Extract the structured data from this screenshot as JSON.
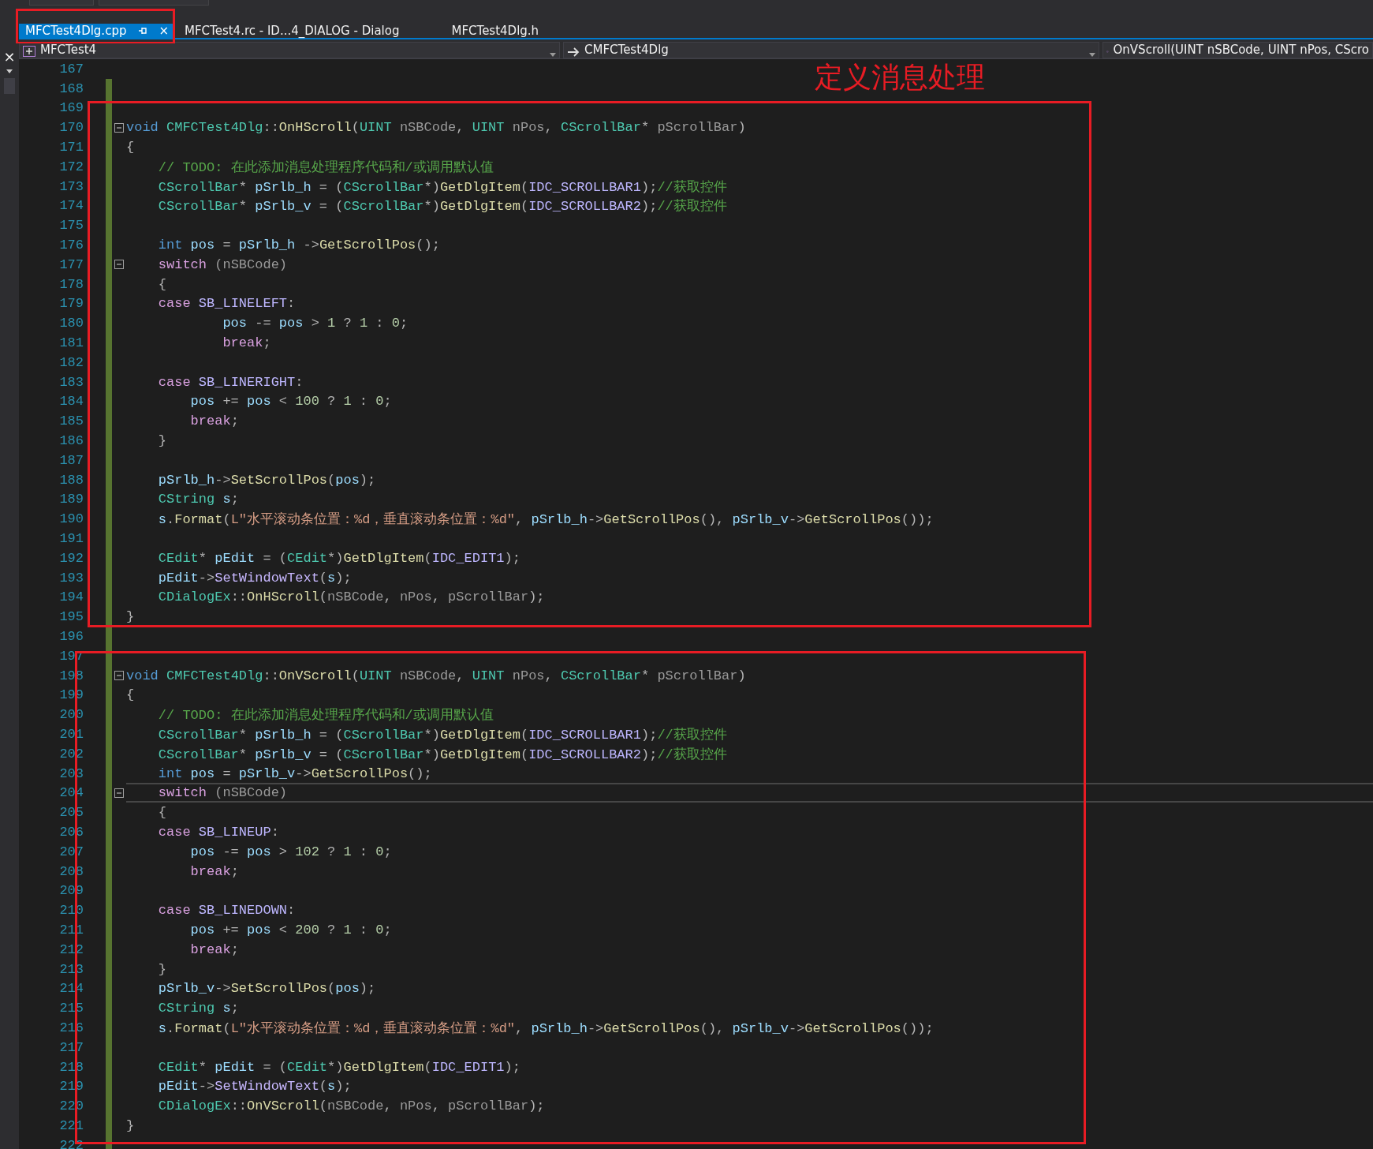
{
  "side_panel": {
    "close": "×"
  },
  "tabs": [
    {
      "label": "MFCTest4Dlg.cpp",
      "selected": true,
      "pinned": true,
      "close": "×"
    },
    {
      "label": "MFCTest4.rc - ID...4_DIALOG - Dialog",
      "selected": false
    },
    {
      "label": "MFCTest4Dlg.h",
      "selected": false
    }
  ],
  "navigation": {
    "project": "MFCTest4",
    "class": "CMFCTest4Dlg",
    "member": "OnVScroll(UINT nSBCode, UINT nPos, CScro"
  },
  "annotation": {
    "label": "定义消息处理"
  },
  "lines": [
    {
      "number": "167",
      "changed": false,
      "current": false
    },
    {
      "number": "168",
      "changed": true,
      "current": false
    },
    {
      "number": "169",
      "changed": true,
      "current": false
    },
    {
      "number": "170",
      "changed": true,
      "current": false,
      "expanded": true,
      "tokens": [
        {
          "kind": "keyword",
          "text": "void"
        },
        {
          "kind": "type",
          "text": " CMFCTest4Dlg"
        },
        {
          "kind": "op",
          "text": "::"
        },
        {
          "kind": "function",
          "text": "OnHScroll"
        },
        {
          "kind": "op",
          "text": "("
        },
        {
          "kind": "type",
          "text": "UINT"
        },
        {
          "kind": "param",
          "text": " nSBCode"
        },
        {
          "kind": "op",
          "text": ", "
        },
        {
          "kind": "type",
          "text": "UINT"
        },
        {
          "kind": "param",
          "text": " nPos"
        },
        {
          "kind": "op",
          "text": ", "
        },
        {
          "kind": "type",
          "text": "CScrollBar"
        },
        {
          "kind": "op",
          "text": "* "
        },
        {
          "kind": "param",
          "text": "pScrollBar"
        },
        {
          "kind": "op",
          "text": ")"
        }
      ]
    },
    {
      "number": "171",
      "changed": true,
      "current": false,
      "tokens": [
        {
          "kind": "op",
          "text": "{"
        }
      ]
    },
    {
      "number": "172",
      "changed": true,
      "current": false,
      "tokens": [
        {
          "kind": "comment",
          "text": "    // TODO: 在此添加消息处理程序代码和/或调用默认值"
        }
      ]
    },
    {
      "number": "173",
      "changed": true,
      "current": false,
      "tokens": [
        {
          "kind": "type",
          "text": "    CScrollBar"
        },
        {
          "kind": "op",
          "text": "* "
        },
        {
          "kind": "variable",
          "text": "pSrlb_h"
        },
        {
          "kind": "op",
          "text": " = ("
        },
        {
          "kind": "type",
          "text": "CScrollBar"
        },
        {
          "kind": "op",
          "text": "*)"
        },
        {
          "kind": "function",
          "text": "GetDlgItem"
        },
        {
          "kind": "op",
          "text": "("
        },
        {
          "kind": "macro",
          "text": "IDC_SCROLLBAR1"
        },
        {
          "kind": "op",
          "text": ");"
        },
        {
          "kind": "comment",
          "text": "//获取控件"
        }
      ]
    },
    {
      "number": "174",
      "changed": true,
      "current": false,
      "tokens": [
        {
          "kind": "type",
          "text": "    CScrollBar"
        },
        {
          "kind": "op",
          "text": "* "
        },
        {
          "kind": "variable",
          "text": "pSrlb_v"
        },
        {
          "kind": "op",
          "text": " = ("
        },
        {
          "kind": "type",
          "text": "CScrollBar"
        },
        {
          "kind": "op",
          "text": "*)"
        },
        {
          "kind": "function",
          "text": "GetDlgItem"
        },
        {
          "kind": "op",
          "text": "("
        },
        {
          "kind": "macro",
          "text": "IDC_SCROLLBAR2"
        },
        {
          "kind": "op",
          "text": ");"
        },
        {
          "kind": "comment",
          "text": "//获取控件"
        }
      ]
    },
    {
      "number": "175",
      "changed": true,
      "current": false
    },
    {
      "number": "176",
      "changed": true,
      "current": false,
      "tokens": [
        {
          "kind": "keyword",
          "text": "    int"
        },
        {
          "kind": "variable",
          "text": " pos"
        },
        {
          "kind": "op",
          "text": " = "
        },
        {
          "kind": "variable",
          "text": "pSrlb_h"
        },
        {
          "kind": "op",
          "text": " ->"
        },
        {
          "kind": "function",
          "text": "GetScrollPos"
        },
        {
          "kind": "op",
          "text": "();"
        }
      ]
    },
    {
      "number": "177",
      "changed": true,
      "current": false,
      "expanded": true,
      "tokens": [
        {
          "kind": "control",
          "text": "    switch"
        },
        {
          "kind": "param",
          "text": " (nSBCode)"
        }
      ]
    },
    {
      "number": "178",
      "changed": true,
      "current": false,
      "tokens": [
        {
          "kind": "op",
          "text": "    {"
        }
      ]
    },
    {
      "number": "179",
      "changed": true,
      "current": false,
      "tokens": [
        {
          "kind": "control",
          "text": "    case"
        },
        {
          "kind": "macro",
          "text": " SB_LINELEFT"
        },
        {
          "kind": "op",
          "text": ":"
        }
      ]
    },
    {
      "number": "180",
      "changed": true,
      "current": false,
      "tokens": [
        {
          "kind": "variable",
          "text": "            pos"
        },
        {
          "kind": "op",
          "text": " -= "
        },
        {
          "kind": "variable",
          "text": "pos"
        },
        {
          "kind": "op",
          "text": " > "
        },
        {
          "kind": "number",
          "text": "1"
        },
        {
          "kind": "op",
          "text": " ? "
        },
        {
          "kind": "number",
          "text": "1"
        },
        {
          "kind": "op",
          "text": " : "
        },
        {
          "kind": "number",
          "text": "0"
        },
        {
          "kind": "op",
          "text": ";"
        }
      ]
    },
    {
      "number": "181",
      "changed": true,
      "current": false,
      "tokens": [
        {
          "kind": "control",
          "text": "            break"
        },
        {
          "kind": "op",
          "text": ";"
        }
      ]
    },
    {
      "number": "182",
      "changed": true,
      "current": false
    },
    {
      "number": "183",
      "changed": true,
      "current": false,
      "tokens": [
        {
          "kind": "control",
          "text": "    case"
        },
        {
          "kind": "macro",
          "text": " SB_LINERIGHT"
        },
        {
          "kind": "op",
          "text": ":"
        }
      ]
    },
    {
      "number": "184",
      "changed": true,
      "current": false,
      "tokens": [
        {
          "kind": "variable",
          "text": "        pos"
        },
        {
          "kind": "op",
          "text": " += "
        },
        {
          "kind": "variable",
          "text": "pos"
        },
        {
          "kind": "op",
          "text": " < "
        },
        {
          "kind": "number",
          "text": "100"
        },
        {
          "kind": "op",
          "text": " ? "
        },
        {
          "kind": "number",
          "text": "1"
        },
        {
          "kind": "op",
          "text": " : "
        },
        {
          "kind": "number",
          "text": "0"
        },
        {
          "kind": "op",
          "text": ";"
        }
      ]
    },
    {
      "number": "185",
      "changed": true,
      "current": false,
      "tokens": [
        {
          "kind": "control",
          "text": "        break"
        },
        {
          "kind": "op",
          "text": ";"
        }
      ]
    },
    {
      "number": "186",
      "changed": true,
      "current": false,
      "tokens": [
        {
          "kind": "op",
          "text": "    }"
        }
      ]
    },
    {
      "number": "187",
      "changed": true,
      "current": false
    },
    {
      "number": "188",
      "changed": true,
      "current": false,
      "tokens": [
        {
          "kind": "variable",
          "text": "    pSrlb_h"
        },
        {
          "kind": "op",
          "text": "->"
        },
        {
          "kind": "function",
          "text": "SetScrollPos"
        },
        {
          "kind": "op",
          "text": "("
        },
        {
          "kind": "variable",
          "text": "pos"
        },
        {
          "kind": "op",
          "text": ");"
        }
      ]
    },
    {
      "number": "189",
      "changed": true,
      "current": false,
      "tokens": [
        {
          "kind": "type",
          "text": "    CString"
        },
        {
          "kind": "variable",
          "text": " s"
        },
        {
          "kind": "op",
          "text": ";"
        }
      ]
    },
    {
      "number": "190",
      "changed": true,
      "current": false,
      "tokens": [
        {
          "kind": "variable",
          "text": "    s"
        },
        {
          "kind": "op",
          "text": "."
        },
        {
          "kind": "function",
          "text": "Format"
        },
        {
          "kind": "op",
          "text": "("
        },
        {
          "kind": "string",
          "text": "L\"水平滚动条位置：%d，垂直滚动条位置：%d\""
        },
        {
          "kind": "op",
          "text": ", "
        },
        {
          "kind": "variable",
          "text": "pSrlb_h"
        },
        {
          "kind": "op",
          "text": "->"
        },
        {
          "kind": "function",
          "text": "GetScrollPos"
        },
        {
          "kind": "op",
          "text": "(), "
        },
        {
          "kind": "variable",
          "text": "pSrlb_v"
        },
        {
          "kind": "op",
          "text": "->"
        },
        {
          "kind": "function",
          "text": "GetScrollPos"
        },
        {
          "kind": "op",
          "text": "());"
        }
      ]
    },
    {
      "number": "191",
      "changed": true,
      "current": false
    },
    {
      "number": "192",
      "changed": true,
      "current": false,
      "tokens": [
        {
          "kind": "type",
          "text": "    CEdit"
        },
        {
          "kind": "op",
          "text": "* "
        },
        {
          "kind": "variable",
          "text": "pEdit"
        },
        {
          "kind": "op",
          "text": " = ("
        },
        {
          "kind": "type",
          "text": "CEdit"
        },
        {
          "kind": "op",
          "text": "*)"
        },
        {
          "kind": "function",
          "text": "GetDlgItem"
        },
        {
          "kind": "op",
          "text": "("
        },
        {
          "kind": "macro",
          "text": "IDC_EDIT1"
        },
        {
          "kind": "op",
          "text": ");"
        }
      ]
    },
    {
      "number": "193",
      "changed": true,
      "current": false,
      "tokens": [
        {
          "kind": "variable",
          "text": "    pEdit"
        },
        {
          "kind": "op",
          "text": "->"
        },
        {
          "kind": "method",
          "text": "SetWindowText"
        },
        {
          "kind": "op",
          "text": "("
        },
        {
          "kind": "variable",
          "text": "s"
        },
        {
          "kind": "op",
          "text": ");"
        }
      ]
    },
    {
      "number": "194",
      "changed": true,
      "current": false,
      "tokens": [
        {
          "kind": "type",
          "text": "    CDialogEx"
        },
        {
          "kind": "op",
          "text": "::"
        },
        {
          "kind": "function",
          "text": "OnHScroll"
        },
        {
          "kind": "op",
          "text": "("
        },
        {
          "kind": "param",
          "text": "nSBCode"
        },
        {
          "kind": "op",
          "text": ", "
        },
        {
          "kind": "param",
          "text": "nPos"
        },
        {
          "kind": "op",
          "text": ", "
        },
        {
          "kind": "param",
          "text": "pScrollBar"
        },
        {
          "kind": "op",
          "text": ");"
        }
      ]
    },
    {
      "number": "195",
      "changed": true,
      "current": false,
      "tokens": [
        {
          "kind": "op",
          "text": "}"
        }
      ]
    },
    {
      "number": "196",
      "changed": true,
      "current": false
    },
    {
      "number": "197",
      "changed": true,
      "current": false
    },
    {
      "number": "198",
      "changed": true,
      "current": false,
      "expanded": true,
      "tokens": [
        {
          "kind": "keyword",
          "text": "void"
        },
        {
          "kind": "type",
          "text": " CMFCTest4Dlg"
        },
        {
          "kind": "op",
          "text": "::"
        },
        {
          "kind": "function",
          "text": "OnVScroll"
        },
        {
          "kind": "op",
          "text": "("
        },
        {
          "kind": "type",
          "text": "UINT"
        },
        {
          "kind": "param",
          "text": " nSBCode"
        },
        {
          "kind": "op",
          "text": ", "
        },
        {
          "kind": "type",
          "text": "UINT"
        },
        {
          "kind": "param",
          "text": " nPos"
        },
        {
          "kind": "op",
          "text": ", "
        },
        {
          "kind": "type",
          "text": "CScrollBar"
        },
        {
          "kind": "op",
          "text": "* "
        },
        {
          "kind": "param",
          "text": "pScrollBar"
        },
        {
          "kind": "op",
          "text": ")"
        }
      ]
    },
    {
      "number": "199",
      "changed": true,
      "current": false,
      "tokens": [
        {
          "kind": "op",
          "text": "{"
        }
      ]
    },
    {
      "number": "200",
      "changed": true,
      "current": false,
      "tokens": [
        {
          "kind": "comment",
          "text": "    // TODO: 在此添加消息处理程序代码和/或调用默认值"
        }
      ]
    },
    {
      "number": "201",
      "changed": true,
      "current": false,
      "tokens": [
        {
          "kind": "type",
          "text": "    CScrollBar"
        },
        {
          "kind": "op",
          "text": "* "
        },
        {
          "kind": "variable",
          "text": "pSrlb_h"
        },
        {
          "kind": "op",
          "text": " = ("
        },
        {
          "kind": "type",
          "text": "CScrollBar"
        },
        {
          "kind": "op",
          "text": "*)"
        },
        {
          "kind": "function",
          "text": "GetDlgItem"
        },
        {
          "kind": "op",
          "text": "("
        },
        {
          "kind": "macro",
          "text": "IDC_SCROLLBAR1"
        },
        {
          "kind": "op",
          "text": ");"
        },
        {
          "kind": "comment",
          "text": "//获取控件"
        }
      ]
    },
    {
      "number": "202",
      "changed": true,
      "current": false,
      "tokens": [
        {
          "kind": "type",
          "text": "    CScrollBar"
        },
        {
          "kind": "op",
          "text": "* "
        },
        {
          "kind": "variable",
          "text": "pSrlb_v"
        },
        {
          "kind": "op",
          "text": " = ("
        },
        {
          "kind": "type",
          "text": "CScrollBar"
        },
        {
          "kind": "op",
          "text": "*)"
        },
        {
          "kind": "function",
          "text": "GetDlgItem"
        },
        {
          "kind": "op",
          "text": "("
        },
        {
          "kind": "macro",
          "text": "IDC_SCROLLBAR2"
        },
        {
          "kind": "op",
          "text": ");"
        },
        {
          "kind": "comment",
          "text": "//获取控件"
        }
      ]
    },
    {
      "number": "203",
      "changed": true,
      "current": false,
      "tokens": [
        {
          "kind": "keyword",
          "text": "    int"
        },
        {
          "kind": "variable",
          "text": " pos"
        },
        {
          "kind": "op",
          "text": " = "
        },
        {
          "kind": "variable",
          "text": "pSrlb_v"
        },
        {
          "kind": "op",
          "text": "->"
        },
        {
          "kind": "function",
          "text": "GetScrollPos"
        },
        {
          "kind": "op",
          "text": "();"
        }
      ]
    },
    {
      "number": "204",
      "changed": true,
      "current": true,
      "expanded": true,
      "tokens": [
        {
          "kind": "control",
          "text": "    switch"
        },
        {
          "kind": "param",
          "text": " (nSBCode)"
        }
      ]
    },
    {
      "number": "205",
      "changed": true,
      "current": false,
      "tokens": [
        {
          "kind": "op",
          "text": "    {"
        }
      ]
    },
    {
      "number": "206",
      "changed": true,
      "current": false,
      "tokens": [
        {
          "kind": "control",
          "text": "    case"
        },
        {
          "kind": "macro",
          "text": " SB_LINEUP"
        },
        {
          "kind": "op",
          "text": ":"
        }
      ]
    },
    {
      "number": "207",
      "changed": true,
      "current": false,
      "tokens": [
        {
          "kind": "variable",
          "text": "        pos"
        },
        {
          "kind": "op",
          "text": " -= "
        },
        {
          "kind": "variable",
          "text": "pos"
        },
        {
          "kind": "op",
          "text": " > "
        },
        {
          "kind": "number",
          "text": "102"
        },
        {
          "kind": "op",
          "text": " ? "
        },
        {
          "kind": "number",
          "text": "1"
        },
        {
          "kind": "op",
          "text": " : "
        },
        {
          "kind": "number",
          "text": "0"
        },
        {
          "kind": "op",
          "text": ";"
        }
      ]
    },
    {
      "number": "208",
      "changed": true,
      "current": false,
      "tokens": [
        {
          "kind": "control",
          "text": "        break"
        },
        {
          "kind": "op",
          "text": ";"
        }
      ]
    },
    {
      "number": "209",
      "changed": true,
      "current": false
    },
    {
      "number": "210",
      "changed": true,
      "current": false,
      "tokens": [
        {
          "kind": "control",
          "text": "    case"
        },
        {
          "kind": "macro",
          "text": " SB_LINEDOWN"
        },
        {
          "kind": "op",
          "text": ":"
        }
      ]
    },
    {
      "number": "211",
      "changed": true,
      "current": false,
      "tokens": [
        {
          "kind": "variable",
          "text": "        pos"
        },
        {
          "kind": "op",
          "text": " += "
        },
        {
          "kind": "variable",
          "text": "pos"
        },
        {
          "kind": "op",
          "text": " < "
        },
        {
          "kind": "number",
          "text": "200"
        },
        {
          "kind": "op",
          "text": " ? "
        },
        {
          "kind": "number",
          "text": "1"
        },
        {
          "kind": "op",
          "text": " : "
        },
        {
          "kind": "number",
          "text": "0"
        },
        {
          "kind": "op",
          "text": ";"
        }
      ]
    },
    {
      "number": "212",
      "changed": true,
      "current": false,
      "tokens": [
        {
          "kind": "control",
          "text": "        break"
        },
        {
          "kind": "op",
          "text": ";"
        }
      ]
    },
    {
      "number": "213",
      "changed": true,
      "current": false,
      "tokens": [
        {
          "kind": "op",
          "text": "    }"
        }
      ]
    },
    {
      "number": "214",
      "changed": true,
      "current": false,
      "tokens": [
        {
          "kind": "variable",
          "text": "    pSrlb_v"
        },
        {
          "kind": "op",
          "text": "->"
        },
        {
          "kind": "function",
          "text": "SetScrollPos"
        },
        {
          "kind": "op",
          "text": "("
        },
        {
          "kind": "variable",
          "text": "pos"
        },
        {
          "kind": "op",
          "text": ");"
        }
      ]
    },
    {
      "number": "215",
      "changed": true,
      "current": false,
      "tokens": [
        {
          "kind": "type",
          "text": "    CString"
        },
        {
          "kind": "variable",
          "text": " s"
        },
        {
          "kind": "op",
          "text": ";"
        }
      ]
    },
    {
      "number": "216",
      "changed": true,
      "current": false,
      "tokens": [
        {
          "kind": "variable",
          "text": "    s"
        },
        {
          "kind": "op",
          "text": "."
        },
        {
          "kind": "function",
          "text": "Format"
        },
        {
          "kind": "op",
          "text": "("
        },
        {
          "kind": "string",
          "text": "L\"水平滚动条位置：%d，垂直滚动条位置：%d\""
        },
        {
          "kind": "op",
          "text": ", "
        },
        {
          "kind": "variable",
          "text": "pSrlb_h"
        },
        {
          "kind": "op",
          "text": "->"
        },
        {
          "kind": "function",
          "text": "GetScrollPos"
        },
        {
          "kind": "op",
          "text": "(), "
        },
        {
          "kind": "variable",
          "text": "pSrlb_v"
        },
        {
          "kind": "op",
          "text": "->"
        },
        {
          "kind": "function",
          "text": "GetScrollPos"
        },
        {
          "kind": "op",
          "text": "());"
        }
      ]
    },
    {
      "number": "217",
      "changed": true,
      "current": false
    },
    {
      "number": "218",
      "changed": true,
      "current": false,
      "tokens": [
        {
          "kind": "type",
          "text": "    CEdit"
        },
        {
          "kind": "op",
          "text": "* "
        },
        {
          "kind": "variable",
          "text": "pEdit"
        },
        {
          "kind": "op",
          "text": " = ("
        },
        {
          "kind": "type",
          "text": "CEdit"
        },
        {
          "kind": "op",
          "text": "*)"
        },
        {
          "kind": "function",
          "text": "GetDlgItem"
        },
        {
          "kind": "op",
          "text": "("
        },
        {
          "kind": "macro",
          "text": "IDC_EDIT1"
        },
        {
          "kind": "op",
          "text": ");"
        }
      ]
    },
    {
      "number": "219",
      "changed": true,
      "current": false,
      "tokens": [
        {
          "kind": "variable",
          "text": "    pEdit"
        },
        {
          "kind": "op",
          "text": "->"
        },
        {
          "kind": "method",
          "text": "SetWindowText"
        },
        {
          "kind": "op",
          "text": "("
        },
        {
          "kind": "variable",
          "text": "s"
        },
        {
          "kind": "op",
          "text": ");"
        }
      ]
    },
    {
      "number": "220",
      "changed": true,
      "current": false,
      "tokens": [
        {
          "kind": "type",
          "text": "    CDialogEx"
        },
        {
          "kind": "op",
          "text": "::"
        },
        {
          "kind": "function",
          "text": "OnVScroll"
        },
        {
          "kind": "op",
          "text": "("
        },
        {
          "kind": "param",
          "text": "nSBCode"
        },
        {
          "kind": "op",
          "text": ", "
        },
        {
          "kind": "param",
          "text": "nPos"
        },
        {
          "kind": "op",
          "text": ", "
        },
        {
          "kind": "param",
          "text": "pScrollBar"
        },
        {
          "kind": "op",
          "text": ");"
        }
      ]
    },
    {
      "number": "221",
      "changed": true,
      "current": false,
      "tokens": [
        {
          "kind": "op",
          "text": "}"
        }
      ]
    },
    {
      "number": "222",
      "changed": true,
      "current": false
    }
  ]
}
